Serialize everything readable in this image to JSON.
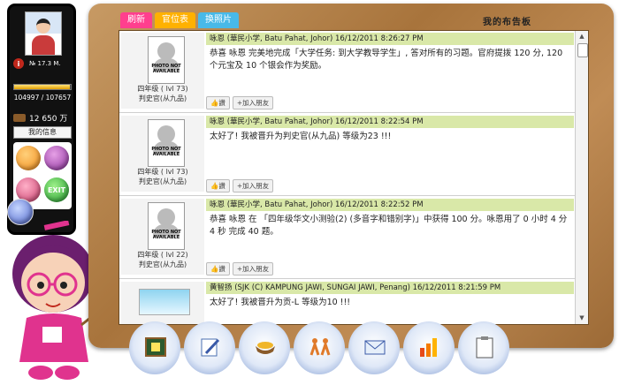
{
  "profile": {
    "info_label": "i",
    "info_text": "№ 17.3 M.",
    "exp_fraction": 0.977,
    "points": "104997 / 107657",
    "money": "12 650 万",
    "info_button": "我的信息",
    "exit_label": "EXIT"
  },
  "tabs": [
    {
      "label": "刷新"
    },
    {
      "label": "官位表"
    },
    {
      "label": "换照片"
    }
  ],
  "board_title": "我的布告板",
  "photo_placeholder": "PHOTO NOT AVAILABLE",
  "actions": {
    "like": "👍讚",
    "add_friend": "+加入朋友"
  },
  "posts": [
    {
      "level": "四年级 ( lvl 73)",
      "rank": "判史官(从九品)",
      "header": "咏恩 (華民小学, Batu Pahat, Johor) 16/12/2011 8:26:27 PM",
      "body": "恭喜 咏恩 完美地完成「大学任务: 到大学教导学生」, 答对所有的习题。官府提拨 120 分, 120 个元宝及 10 个银会作为奖励。"
    },
    {
      "level": "四年级 ( lvl 73)",
      "rank": "判史官(从九品)",
      "header": "咏恩 (華民小学, Batu Pahat, Johor) 16/12/2011 8:22:54 PM",
      "body": "太好了! 我被晋升为判史官(从九品) 等级为23 !!!"
    },
    {
      "level": "四年级 ( lvl 22)",
      "rank": "判史官(从九品)",
      "header": "咏恩 (華民小学, Batu Pahat, Johor) 16/12/2011 8:22:52 PM",
      "body": "恭喜 咏恩 在 「四年级华文小测验(2) (多音字和错别字)」中获得 100 分。咏恩用了 0 小时 4 分 4 秒 完成 40 题。"
    },
    {
      "level": "",
      "rank": "",
      "header": "黄智扬 (SJK (C) KAMPUNG JAWI, SUNGAI JAWI, Penang) 16/12/2011 8:21:59 PM",
      "body": "太好了! 我被晋升为贡-L 等级为10 !!!"
    }
  ],
  "dock": [
    {
      "icon": "notice-board-icon"
    },
    {
      "icon": "pencil-icon"
    },
    {
      "icon": "gold-ingot-icon"
    },
    {
      "icon": "people-icon"
    },
    {
      "icon": "mail-icon"
    },
    {
      "icon": "bar-chart-icon"
    },
    {
      "icon": "clipboard-icon"
    }
  ]
}
